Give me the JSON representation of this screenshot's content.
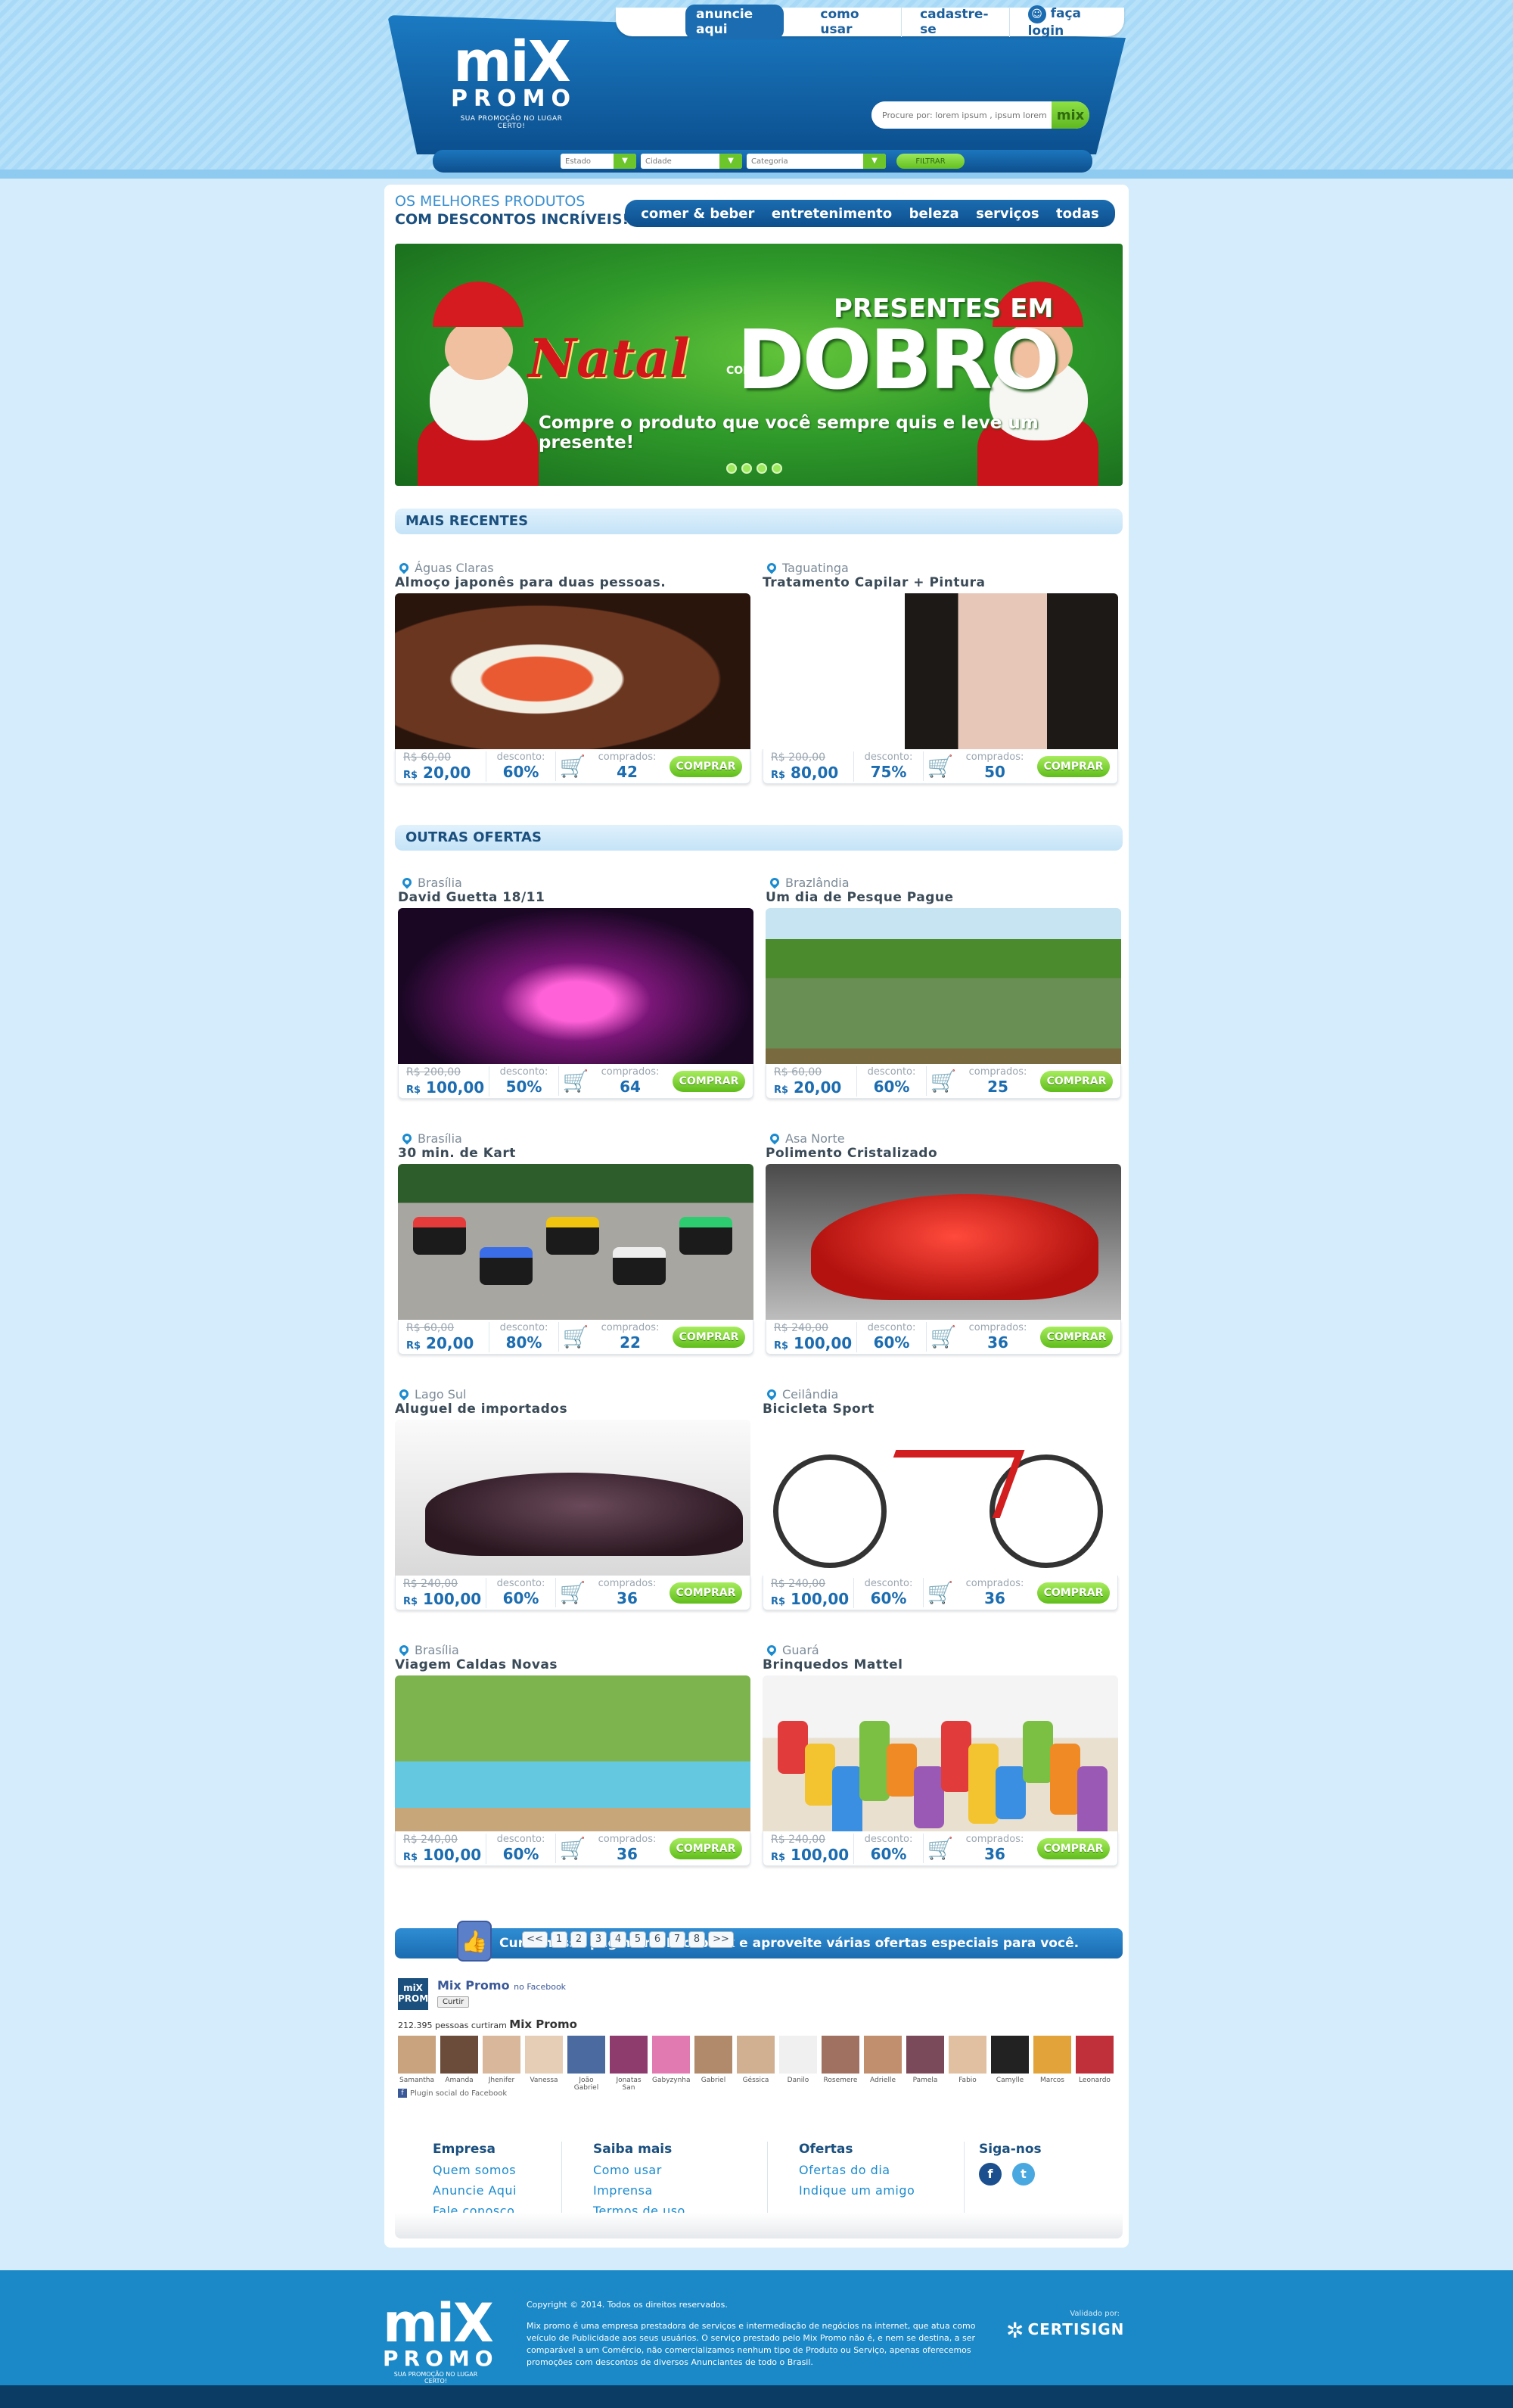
{
  "header": {
    "nav": {
      "advertise": "anuncie aqui",
      "how": "como usar",
      "register": "cadastre-se",
      "login": "faça login"
    },
    "logo": {
      "line1": "miX",
      "line2": "PROMO",
      "tagline": "SUA PROMOÇÃO NO LUGAR CERTO!"
    },
    "search": {
      "placeholder": "Procure por: lorem ipsum , ipsum lorem",
      "button": "mix"
    },
    "filters": {
      "state": "Estado",
      "city": "Cidade",
      "category": "Categoria",
      "button": "FILTRAR"
    }
  },
  "tagline": {
    "line1": "OS MELHORES PRODUTOS",
    "line2": "COM DESCONTOS INCRÍVEIS!"
  },
  "categories": [
    "comer & beber",
    "entretenimento",
    "beleza",
    "serviços",
    "todas"
  ],
  "banner": {
    "natal": "Natal",
    "com": "COM",
    "presentes": "PRESENTES EM",
    "dobro": "DOBRO",
    "sub": "Compre o produto que você sempre quis e leve um presente!"
  },
  "sections": {
    "recent": "MAIS RECENTES",
    "others": "OUTRAS OFERTAS"
  },
  "labels": {
    "discount": "desconto:",
    "bought": "comprados:",
    "buy": "COMPRAR",
    "currency": "R$"
  },
  "recent": [
    {
      "location": "Águas Claras",
      "title": "Almoço japonês para duas pessoas.",
      "old": "R$ 60,00",
      "price": "20,00",
      "discount": "60%",
      "bought": "42"
    },
    {
      "location": "Taguatinga",
      "title": "Tratamento Capilar + Pintura",
      "old": "R$ 200,00",
      "price": "80,00",
      "discount": "75%",
      "bought": "50"
    }
  ],
  "offers": [
    {
      "location": "Brasília",
      "title": "David Guetta 18/11",
      "old": "R$ 200,00",
      "price": "100,00",
      "discount": "50%",
      "bought": "64"
    },
    {
      "location": "Brazlândia",
      "title": "Um dia de Pesque Pague",
      "old": "R$ 60,00",
      "price": "20,00",
      "discount": "60%",
      "bought": "25"
    },
    {
      "location": "Brasília",
      "title": "30 min. de Kart",
      "old": "R$ 60,00",
      "price": "20,00",
      "discount": "80%",
      "bought": "22"
    },
    {
      "location": "Asa Norte",
      "title": "Polimento Cristalizado",
      "old": "R$ 240,00",
      "price": "100,00",
      "discount": "60%",
      "bought": "36"
    },
    {
      "location": "Lago Sul",
      "title": "Aluguel de importados",
      "old": "R$ 240,00",
      "price": "100,00",
      "discount": "60%",
      "bought": "36"
    },
    {
      "location": "Ceilândia",
      "title": "Bicicleta Sport",
      "old": "R$ 240,00",
      "price": "100,00",
      "discount": "60%",
      "bought": "36"
    },
    {
      "location": "Brasília",
      "title": "Viagem Caldas Novas",
      "old": "R$ 240,00",
      "price": "100,00",
      "discount": "60%",
      "bought": "36"
    },
    {
      "location": "Guará",
      "title": "Brinquedos Mattel",
      "old": "R$ 240,00",
      "price": "100,00",
      "discount": "60%",
      "bought": "36"
    }
  ],
  "pagination": [
    "<<",
    "1",
    "2",
    "3",
    "4",
    "5",
    "6",
    "7",
    "8",
    ">>"
  ],
  "facebook": {
    "bar": "Curta nossa página no Facebook e aproveite várias ofertas especiais para você.",
    "logo": "miX PROMO",
    "page_name": "Mix Promo",
    "on_fb": "no Facebook",
    "like": "Curtir",
    "count_prefix": "212.395 pessoas curtiram",
    "count_name": "Mix Promo",
    "plugin": "Plugin social do Facebook",
    "people": [
      "Samantha",
      "Amanda",
      "Jhenifer",
      "Vanessa",
      "João Gabriel",
      "Jonatas San",
      "Gabyzynha",
      "Gabriel",
      "Géssica",
      "Danilo",
      "Rosemere",
      "Adrielle",
      "Pamela",
      "Fabio",
      "Camylle",
      "Marcos",
      "Leonardo"
    ]
  },
  "footer": {
    "col1": {
      "title": "Empresa",
      "links": [
        "Quem somos",
        "Anuncie Aqui",
        "Fale conosco"
      ]
    },
    "col2": {
      "title": "Saiba mais",
      "links": [
        "Como usar",
        "Imprensa",
        "Termos de uso"
      ]
    },
    "col3": {
      "title": "Ofertas",
      "links": [
        "Ofertas do dia",
        "Indique um amigo"
      ]
    },
    "col4": {
      "title": "Siga-nos",
      "facebook": "f",
      "twitter": "t"
    },
    "copyright": "Copyright © 2014. Todos os direitos reservados.",
    "about": "Mix promo é uma empresa prestadora de serviços e intermediação de negócios na internet, que atua como veículo de Publicidade aos seus usuários. O serviço prestado pelo Mix Promo não é, e nem se destina, a ser comparável a um Comércio, não comercializamos nenhum tipo de Produto ou Serviço, apenas oferecemos promoções com descontos de diversos Anunciantes de todo o Brasil.",
    "validated": "Validado por:",
    "certisign": "CERTISIGN"
  },
  "colors": {
    "brand": "#1b6cb0",
    "accent": "#6cc52b",
    "background": "#d4ecfb"
  }
}
